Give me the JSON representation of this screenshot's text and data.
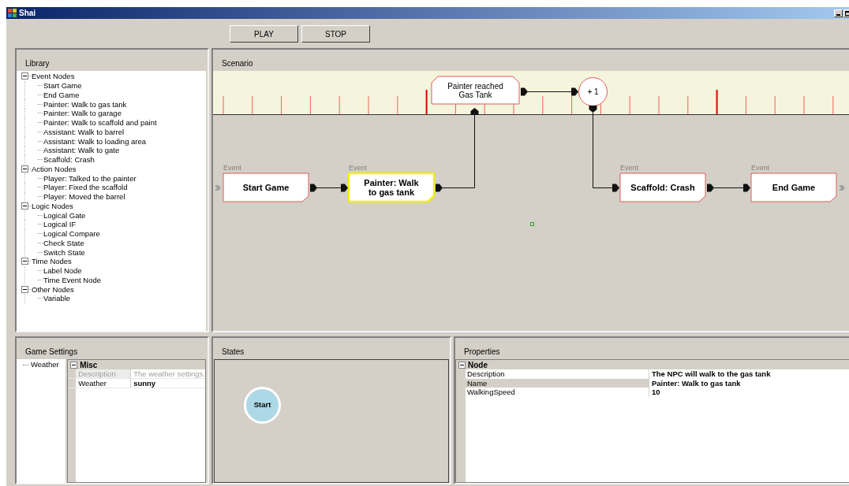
{
  "window": {
    "title": "Shai"
  },
  "toolbar": {
    "buttons": [
      "PLAY",
      "STOP"
    ]
  },
  "library": {
    "title": "Library",
    "tree": [
      {
        "label": "Event Nodes",
        "expanded": true,
        "children": [
          {
            "label": "Start Game"
          },
          {
            "label": "End Game"
          },
          {
            "label": "Painter: Walk to gas tank"
          },
          {
            "label": "Painter: Walk to garage"
          },
          {
            "label": "Painter: Walk to scaffold and paint"
          },
          {
            "label": "Assistant: Walk to barrel"
          },
          {
            "label": "Assistant: Walk to loading area"
          },
          {
            "label": "Assistant: Walk to gate"
          },
          {
            "label": "Scaffold: Crash"
          }
        ]
      },
      {
        "label": "Action Nodes",
        "expanded": true,
        "children": [
          {
            "label": "Player: Talked to the painter"
          },
          {
            "label": "Player: Fixed the scaffold"
          },
          {
            "label": "Player: Moved the barrel"
          }
        ]
      },
      {
        "label": "Logic Nodes",
        "expanded": true,
        "children": [
          {
            "label": "Logical Gate"
          },
          {
            "label": "Logical IF"
          },
          {
            "label": "Logical Compare"
          },
          {
            "label": "Check State"
          },
          {
            "label": "Switch State"
          }
        ]
      },
      {
        "label": "Time Nodes",
        "expanded": true,
        "children": [
          {
            "label": "Label Node"
          },
          {
            "label": "Time Event Node"
          }
        ]
      },
      {
        "label": "Other Nodes",
        "expanded": true,
        "children": [
          {
            "label": "Variable"
          }
        ]
      }
    ]
  },
  "scenario": {
    "title": "Scenario",
    "nodes": [
      {
        "kind": "trigger",
        "label": "Painter reached Gas Tank",
        "selected": false
      },
      {
        "kind": "counter",
        "label": "+ 1",
        "selected": false
      },
      {
        "kind": "event",
        "caption": "Event",
        "label": "Start Game",
        "selected": false
      },
      {
        "kind": "event",
        "caption": "Event",
        "label": "Painter: Walk to gas tank",
        "selected": true
      },
      {
        "kind": "event",
        "caption": "Event",
        "label": "Scaffold: Crash",
        "selected": false
      },
      {
        "kind": "event",
        "caption": "Event",
        "label": "End Game",
        "selected": false
      }
    ]
  },
  "game_settings": {
    "title": "Game Settings",
    "tree": [
      {
        "label": "Weather"
      }
    ],
    "grid": {
      "category": "Misc",
      "expanded": true,
      "rows": [
        {
          "name": "Description",
          "value": "The weather settings.",
          "disabled": true
        },
        {
          "name": "Weather",
          "value": "sunny",
          "disabled": false
        }
      ]
    }
  },
  "states": {
    "title": "States",
    "nodes": [
      {
        "label": "Start"
      }
    ]
  },
  "properties": {
    "title": "Properties",
    "category": "Node",
    "expanded": true,
    "rows": [
      {
        "name": "Description",
        "value": "The NPC will walk to the gas tank",
        "selected": false
      },
      {
        "name": "Name",
        "value": "Painter: Walk to gas tank",
        "selected": true
      },
      {
        "name": "WalkingSpeed",
        "value": "10",
        "selected": false
      }
    ]
  }
}
